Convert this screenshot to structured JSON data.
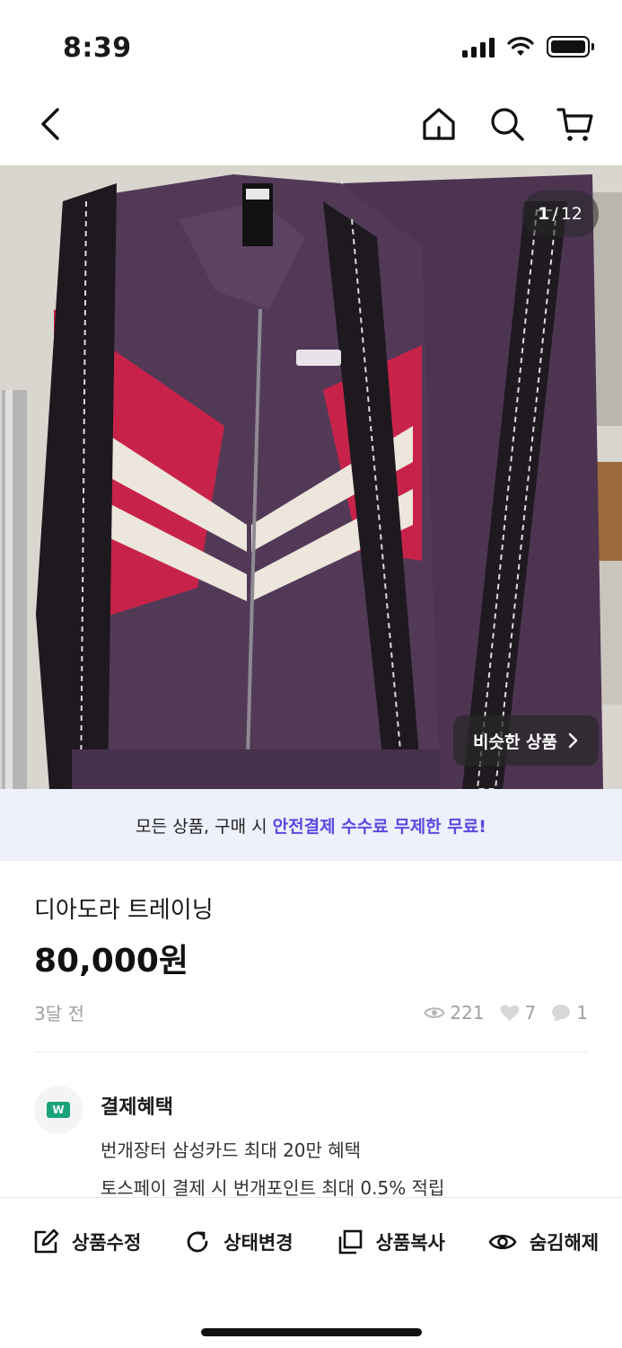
{
  "status_bar": {
    "time": "8:39"
  },
  "nav": {
    "back_icon": "chevron-left-icon",
    "home_icon": "home-icon",
    "search_icon": "search-icon",
    "cart_icon": "cart-icon"
  },
  "hero": {
    "counter_current": "1",
    "counter_total": "12",
    "similar_button": "비슷한 상품"
  },
  "banner": {
    "prefix": "모든 상품, 구매 시",
    "highlight": "안전결제 수수료 무제한 무료!",
    "highlight_color": "#5b49e0"
  },
  "product": {
    "title": "디아도라 트레이닝",
    "price": "80,000원",
    "posted": "3달 전",
    "views": "221",
    "likes": "7",
    "chats": "1"
  },
  "benefits": {
    "logo_text": "W",
    "title": "결제혜택",
    "line1": "번개장터 삼성카드 최대 20만 혜택",
    "line2": "토스페이 결제 시 번개포인트 최대 0.5% 적립"
  },
  "actions": [
    {
      "label": "상품수정",
      "icon": "edit-icon"
    },
    {
      "label": "상태변경",
      "icon": "refresh-icon"
    },
    {
      "label": "상품복사",
      "icon": "copy-icon"
    },
    {
      "label": "숨김해제",
      "icon": "eye-icon"
    }
  ]
}
